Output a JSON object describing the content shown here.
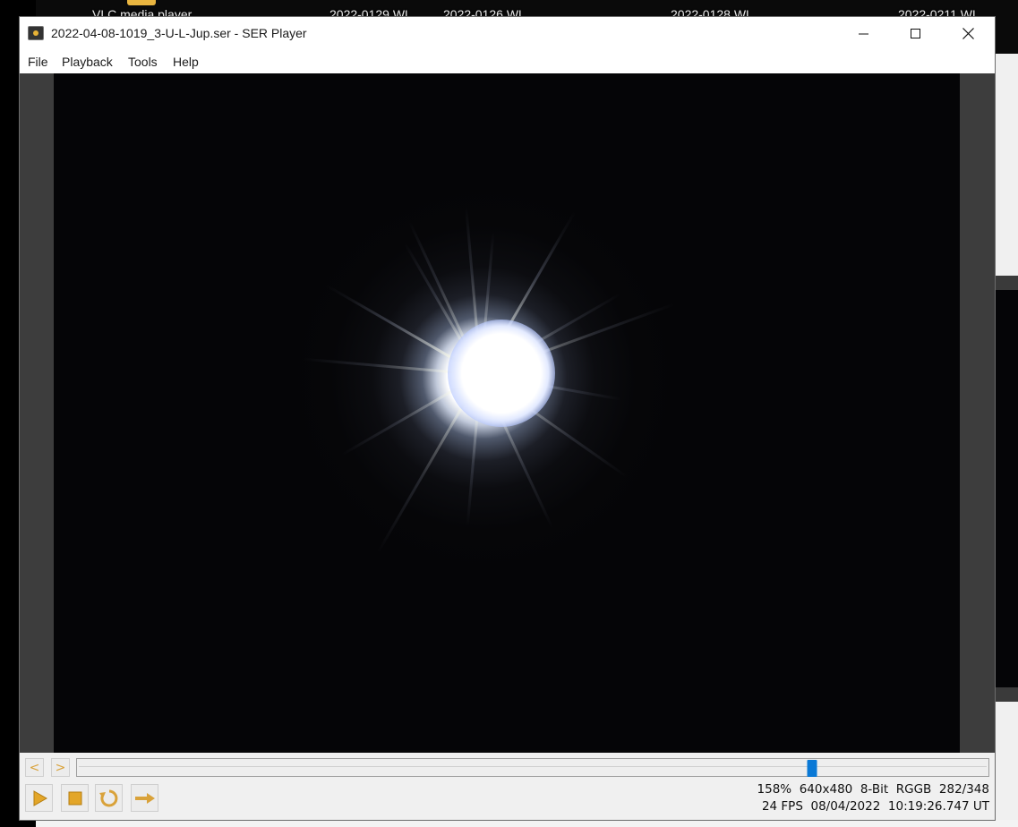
{
  "desktop": {
    "icons": [
      {
        "label": "VLC media player"
      },
      {
        "label": "2022-0129 WL"
      },
      {
        "label": "2022-0126 WL"
      },
      {
        "label": "2022-0128 WL"
      },
      {
        "label": "2022-0211 WL"
      }
    ]
  },
  "window": {
    "title": "2022-04-08-1019_3-U-L-Jup.ser - SER Player",
    "controls": {
      "minimize": "minimize",
      "maximize": "maximize",
      "close": "close"
    }
  },
  "menu": {
    "items": [
      {
        "label": "File"
      },
      {
        "label": "Playback"
      },
      {
        "label": "Tools"
      },
      {
        "label": "Help"
      }
    ]
  },
  "playback": {
    "prev_label": "<",
    "next_label": ">",
    "current_frame": 282,
    "total_frames": 348,
    "progress": 0.81,
    "icons": {
      "play": "play-icon",
      "stop": "stop-icon",
      "repeat": "repeat-icon",
      "forward": "forward-arrow-icon"
    },
    "accent": "#d9a23a",
    "thumb_color": "#0a79d6"
  },
  "status": {
    "zoom": "158%",
    "resolution": "640x480",
    "bit_depth": "8-Bit",
    "color_id": "RGGB",
    "frame_counter": "282/348",
    "fps": "24 FPS",
    "date": "08/04/2022",
    "time": "10:19:26.747 UT"
  }
}
